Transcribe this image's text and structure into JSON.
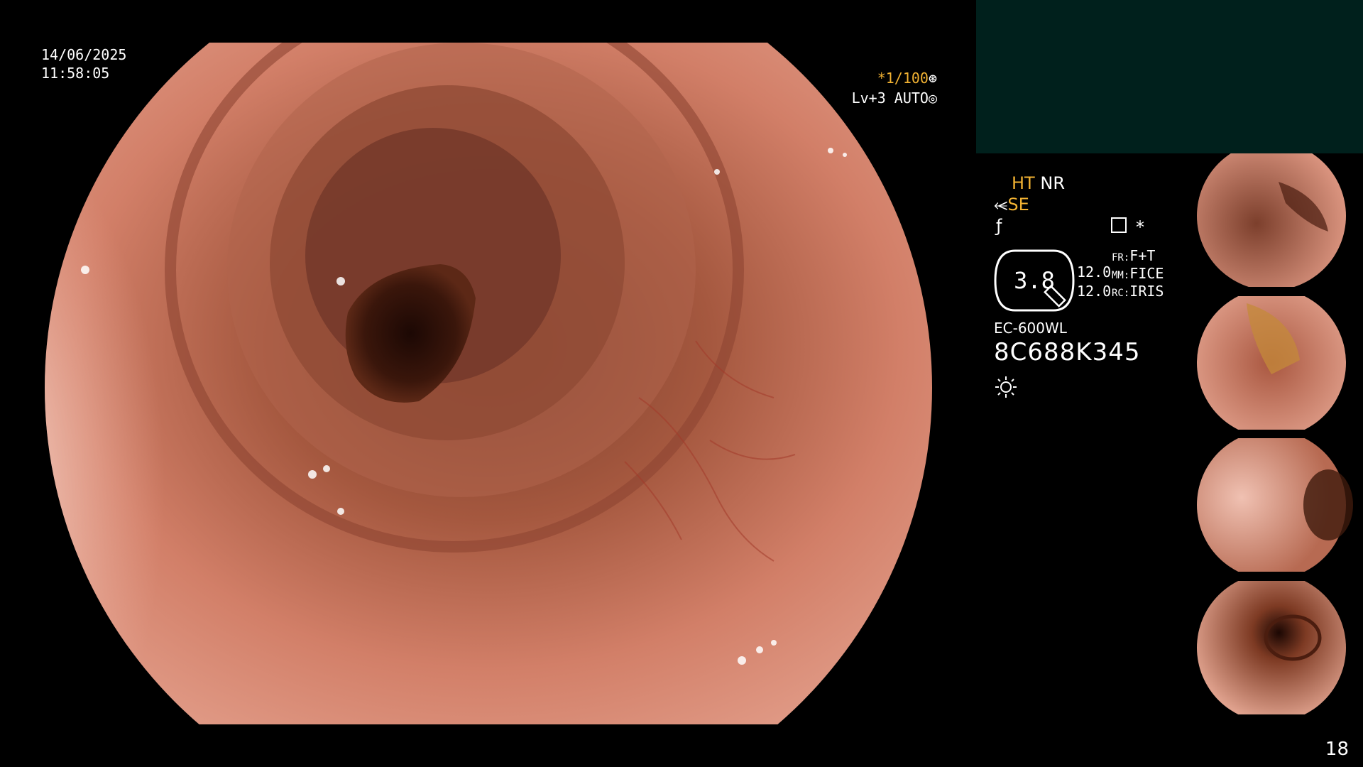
{
  "overlay": {
    "date": "14/06/2025",
    "time": "11:58:05",
    "shutter": "*1/100",
    "level": "Lv+3 AUTO"
  },
  "settings": {
    "ht": "HT",
    "nr": "NR",
    "se": "SE",
    "dial_value": "3.8",
    "value_1": "12.0",
    "value_2": "12.0",
    "fr_label": "FR:",
    "fr_value": "F+T",
    "mm_label": "MM:",
    "mm_value": "FICE",
    "rc_label": "RC:",
    "rc_value": "IRIS",
    "scope_model": "EC-600WL",
    "serial": "8C688K345"
  },
  "icons": {
    "shutter": "aperture-icon",
    "level": "iris-icon",
    "se": "se-icon",
    "f": "f-icon",
    "hist": "histogram-icon",
    "star": "asterisk-icon",
    "sun": "sun-icon"
  },
  "thumbnails": [
    {
      "name": "thumbnail-1",
      "index": "1"
    },
    {
      "name": "thumbnail-2",
      "index": "2"
    },
    {
      "name": "thumbnail-3",
      "index": "3"
    },
    {
      "name": "thumbnail-4",
      "index": "4"
    }
  ],
  "page_number": "18",
  "colors": {
    "accent_orange": "#f2b232",
    "panel_teal": "#00201c",
    "background": "#000000"
  }
}
